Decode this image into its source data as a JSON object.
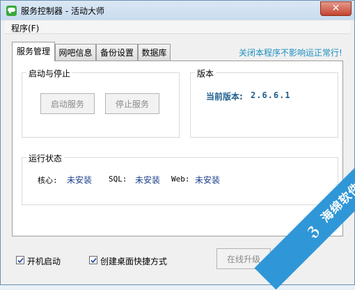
{
  "window": {
    "title": "服务控制器 - 活动大师"
  },
  "titlebar": {
    "close_glyph": "✕"
  },
  "menu": {
    "program": "程序(F)"
  },
  "tabs": [
    {
      "label": "服务管理",
      "active": true
    },
    {
      "label": "网吧信息"
    },
    {
      "label": "备份设置"
    },
    {
      "label": "数据库"
    }
  ],
  "notice": "关闭本程序不影响运正常行!",
  "start_stop": {
    "title": "启动与停止",
    "start_button": "启动服务",
    "stop_button": "停止服务"
  },
  "version": {
    "title": "版本",
    "label": "当前版本:",
    "value": "2.6.6.1"
  },
  "run_status": {
    "title": "运行状态",
    "items": [
      {
        "label": "核心:",
        "value": "未安装"
      },
      {
        "label": "SQL:",
        "value": "未安装"
      },
      {
        "label": "Web:",
        "value": "未安装"
      }
    ]
  },
  "footer": {
    "autostart_label": "开机启动",
    "autostart_checked": true,
    "shortcut_label": "创建桌面快捷方式",
    "shortcut_checked": true,
    "upgrade_button": "在线升级"
  },
  "watermark": {
    "logo_glyph": "ℨ",
    "text": "海绵软件"
  },
  "colors": {
    "accent": "#1b8fc2",
    "version": "#1f5f8f",
    "status_value": "#1a3f8a",
    "watermark": "#2f97d7"
  }
}
